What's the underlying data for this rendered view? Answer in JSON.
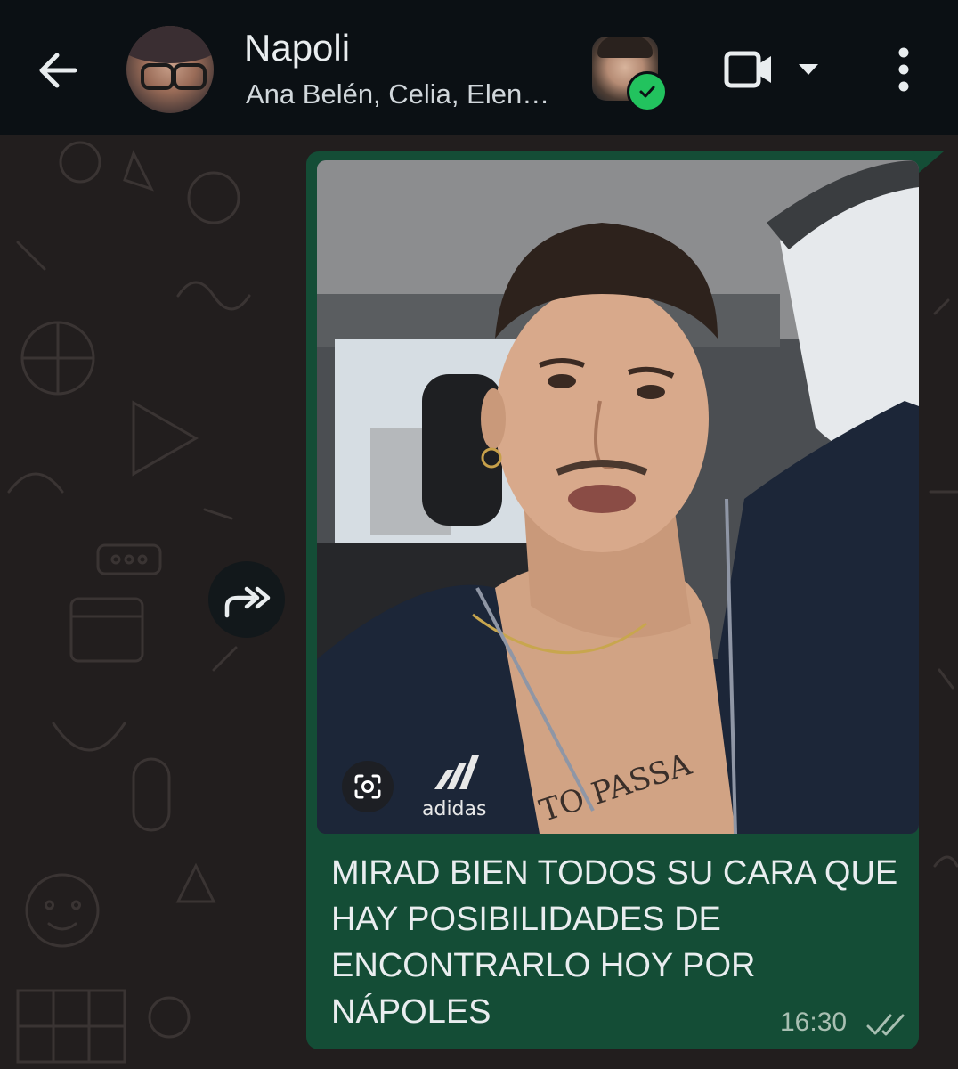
{
  "header": {
    "title": "Napoli",
    "subtitle": "Ana Belén, Celia, Elen…"
  },
  "message": {
    "caption": "MIRAD BIEN TODOS SU CARA QUE HAY POSIBILIDADES DE ENCONTRARLO HOY POR NÁPOLES",
    "time": "16:30",
    "status": "read",
    "photo_text": "TO PASSA",
    "photo_logo": "adidas"
  },
  "icons": {
    "back": "arrow-left-icon",
    "video": "video-camera-icon",
    "dropdown": "caret-down-icon",
    "menu": "more-vertical-icon",
    "forward": "forward-icon",
    "lens": "lens-search-icon",
    "ticks": "double-check-icon",
    "verified": "check-badge-icon"
  },
  "colors": {
    "header_bg": "#0b1014",
    "chat_bg": "#221e1e",
    "bubble_bg": "#144d36",
    "badge_green": "#22c35e",
    "text_primary": "#e9edef"
  }
}
